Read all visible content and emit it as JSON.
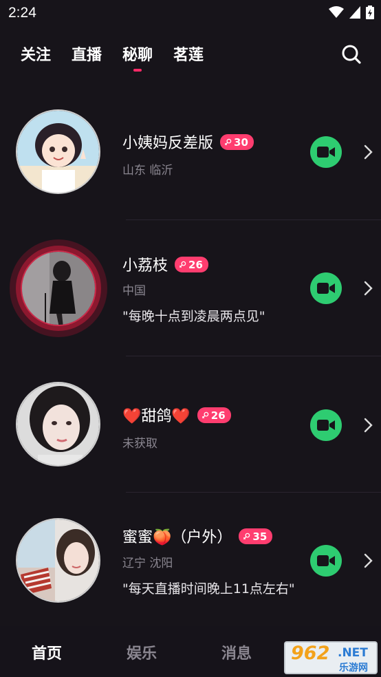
{
  "status": {
    "time": "2:24"
  },
  "top_tabs": [
    {
      "label": "关注"
    },
    {
      "label": "直播"
    },
    {
      "label": "秘聊",
      "active": true
    },
    {
      "label": "茗莲"
    }
  ],
  "users": [
    {
      "name": "小姨妈反差版",
      "age": "30",
      "location": "山东 临沂",
      "quote": ""
    },
    {
      "name": "小荔枝",
      "age": "26",
      "location": "中国",
      "quote": "\"每晚十点到凌晨两点见\""
    },
    {
      "name": "❤️甜鸽❤️",
      "age": "26",
      "location": "未获取",
      "quote": ""
    },
    {
      "name": "蜜蜜🍑（户外）",
      "age": "35",
      "location": "辽宁 沈阳",
      "quote": "\"每天直播时间晚上11点左右\""
    }
  ],
  "bottom_nav": [
    {
      "label": "首页",
      "active": true
    },
    {
      "label": "娱乐"
    },
    {
      "label": "消息"
    }
  ],
  "watermark": {
    "number": "962",
    "suffix": ".NET",
    "sub": "乐游网"
  },
  "colors": {
    "accent": "#ff2a67",
    "badge": "#ff3d6f",
    "call": "#2ecc71",
    "background": "#17141a"
  }
}
